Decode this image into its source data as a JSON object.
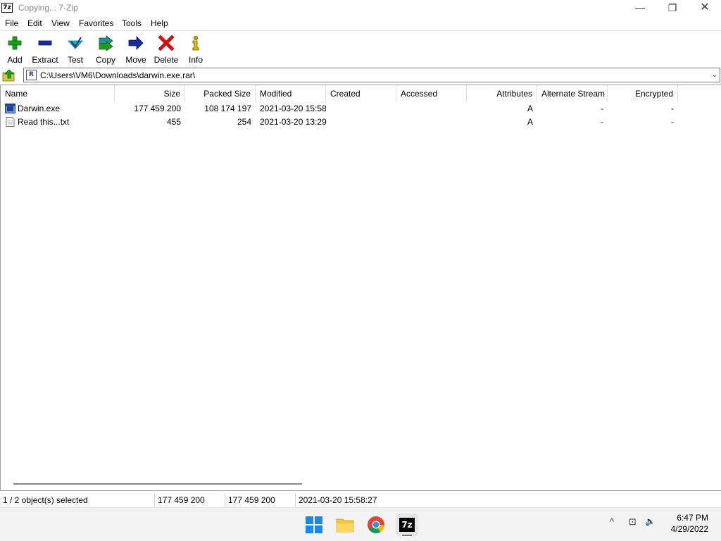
{
  "window": {
    "app_icon_text": "7z",
    "title": "Copying... 7-Zip",
    "controls": {
      "minimize": "—",
      "maximize": "❐",
      "close": "✕"
    }
  },
  "menu": [
    "File",
    "Edit",
    "View",
    "Favorites",
    "Tools",
    "Help"
  ],
  "toolbar": [
    {
      "label": "Add",
      "icon": "add-icon",
      "color": "#1aa11a"
    },
    {
      "label": "Extract",
      "icon": "extract-icon",
      "color": "#1a2b9c"
    },
    {
      "label": "Test",
      "icon": "test-icon",
      "color": "#21b5b5"
    },
    {
      "label": "Copy",
      "icon": "copy-icon",
      "color": "#2a8f8f"
    },
    {
      "label": "Move",
      "icon": "move-icon",
      "color": "#1a2b9c"
    },
    {
      "label": "Delete",
      "icon": "delete-icon",
      "color": "#d01010"
    },
    {
      "label": "Info",
      "icon": "info-icon",
      "color": "#c8a800"
    }
  ],
  "address": {
    "icon_text": "R",
    "path": "C:\\Users\\VM6\\Downloads\\darwin.exe.rar\\"
  },
  "columns": [
    "Name",
    "Size",
    "Packed Size",
    "Modified",
    "Created",
    "Accessed",
    "Attributes",
    "Alternate Stream",
    "Encrypted"
  ],
  "files": [
    {
      "name": "Darwin.exe",
      "size": "177 459 200",
      "packed": "108 174 197",
      "modified": "2021-03-20 15:58",
      "created": "",
      "accessed": "",
      "attributes": "A",
      "alt_stream": "-",
      "encrypted": "-",
      "icon": "exe-file-icon",
      "selected": true
    },
    {
      "name": "Read this...txt",
      "size": "455",
      "packed": "254",
      "modified": "2021-03-20 13:29",
      "created": "",
      "accessed": "",
      "attributes": "A",
      "alt_stream": "-",
      "encrypted": "-",
      "icon": "text-file-icon",
      "selected": false
    }
  ],
  "status": {
    "selection": "1 / 2 object(s) selected",
    "size": "177 459 200",
    "packed": "177 459 200",
    "modified": "2021-03-20 15:58:27"
  },
  "taskbar": {
    "apps": [
      "start-icon",
      "file-explorer-icon",
      "chrome-icon",
      "7zip-icon"
    ],
    "sevenzip_text": "7z",
    "tray": {
      "chevron": "^",
      "network": "⊡",
      "volume": "🔈"
    },
    "time": "6:47 PM",
    "date": "4/29/2022"
  }
}
